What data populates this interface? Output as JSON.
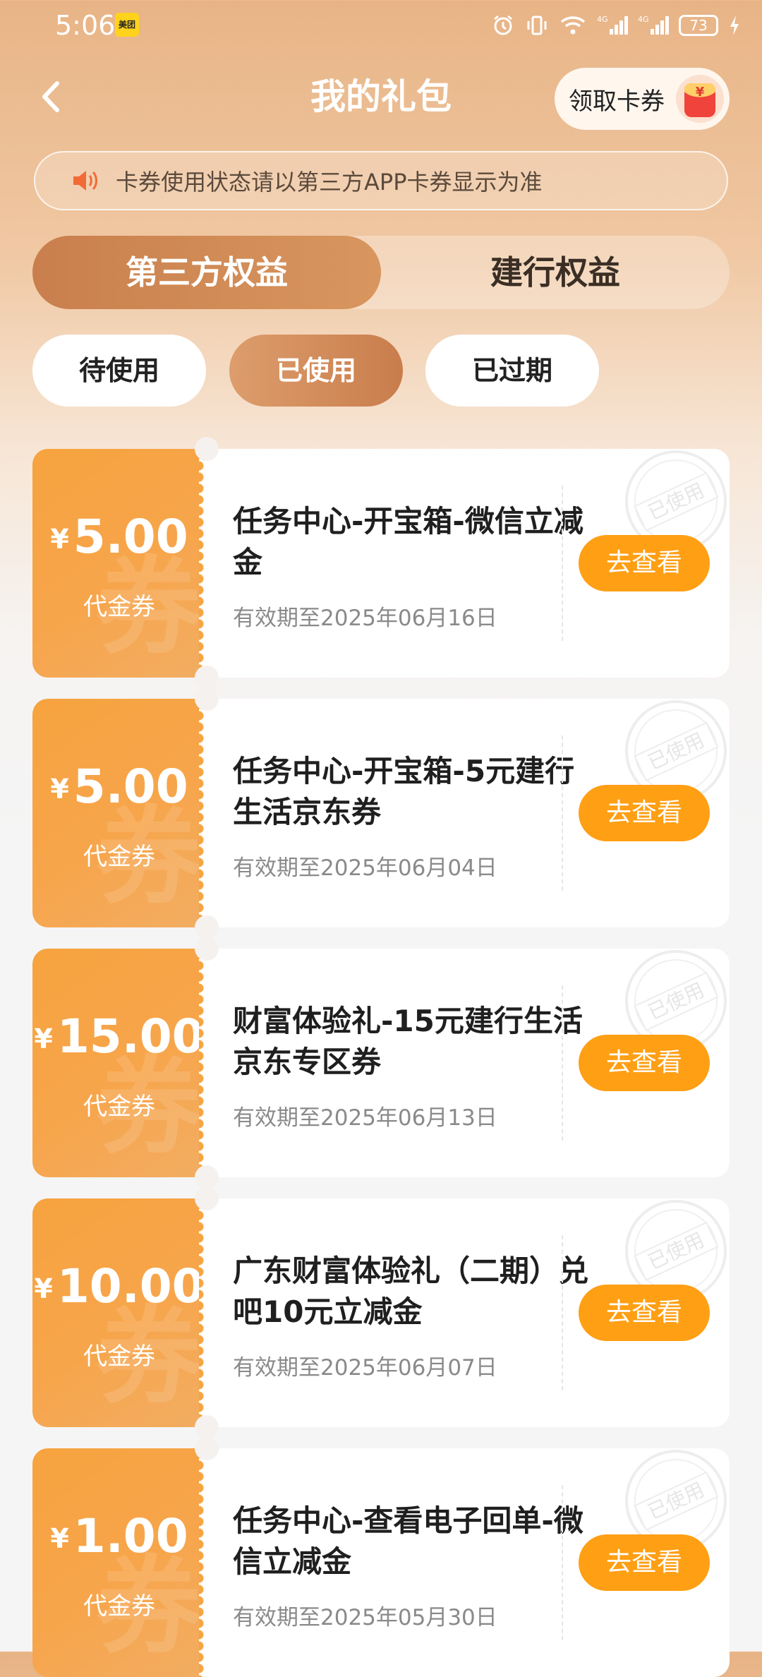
{
  "status_bar": {
    "time": "5:06",
    "app_badge": "美团",
    "battery": "73"
  },
  "header": {
    "title": "我的礼包",
    "claim_button": "领取卡券",
    "redpacket_symbol": "¥"
  },
  "notice": {
    "text": "卡券使用状态请以第三方APP卡券显示为准"
  },
  "main_tabs": [
    {
      "label": "第三方权益",
      "active": true
    },
    {
      "label": "建行权益",
      "active": false
    }
  ],
  "filters": [
    {
      "label": "待使用",
      "active": false
    },
    {
      "label": "已使用",
      "active": true
    },
    {
      "label": "已过期",
      "active": false
    }
  ],
  "coupons": [
    {
      "currency": "¥",
      "amount": "5.00",
      "type": "代金券",
      "title": "任务中心-开宝箱-微信立减金",
      "validity": "有效期至2025年06月16日",
      "button": "去查看",
      "stamp": "已使用"
    },
    {
      "currency": "¥",
      "amount": "5.00",
      "type": "代金券",
      "title": "任务中心-开宝箱-5元建行生活京东券",
      "validity": "有效期至2025年06月04日",
      "button": "去查看",
      "stamp": "已使用"
    },
    {
      "currency": "¥",
      "amount": "15.00",
      "type": "代金券",
      "title": "财富体验礼-15元建行生活京东专区券",
      "validity": "有效期至2025年06月13日",
      "button": "去查看",
      "stamp": "已使用"
    },
    {
      "currency": "¥",
      "amount": "10.00",
      "type": "代金券",
      "title": "广东财富体验礼（二期）兑吧10元立减金",
      "validity": "有效期至2025年06月07日",
      "button": "去查看",
      "stamp": "已使用"
    },
    {
      "currency": "¥",
      "amount": "1.00",
      "type": "代金券",
      "title": "任务中心-查看电子回单-微信立减金",
      "validity": "有效期至2025年05月30日",
      "button": "去查看",
      "stamp": "已使用"
    }
  ],
  "coupon_watermark": "券",
  "colors": {
    "accent_orange": "#ff9f14",
    "tab_active": "#c97f4d",
    "coupon_left": "#f6a33f"
  }
}
